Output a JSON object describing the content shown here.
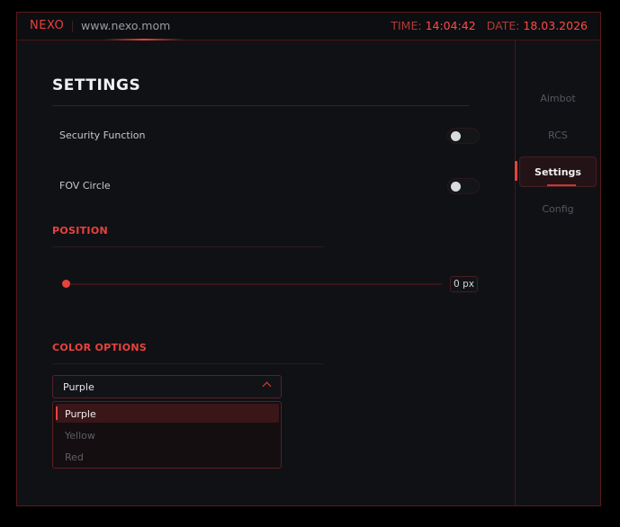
{
  "topbar": {
    "brand": "NEXO",
    "url": "www.nexo.mom",
    "time_label": "TIME:",
    "time_value": "14:04:42",
    "date_label": "DATE:",
    "date_value": "18.03.2026"
  },
  "sidebar": {
    "items": [
      {
        "label": "Aimbot"
      },
      {
        "label": "RCS"
      },
      {
        "label": "Settings"
      },
      {
        "label": "Config"
      }
    ],
    "active_index": 2
  },
  "main": {
    "title": "SETTINGS",
    "security_label": "Security Function",
    "security_on": false,
    "fov_label": "FOV Circle",
    "fov_on": false,
    "position_header": "POSITION",
    "position_value": 0,
    "position_value_text": "0 px",
    "color_header": "COLOR OPTIONS",
    "color_selected": "Purple",
    "color_options": [
      "Purple",
      "Yellow",
      "Red"
    ]
  },
  "colors": {
    "accent": "#e8423d",
    "background": "#101115"
  }
}
